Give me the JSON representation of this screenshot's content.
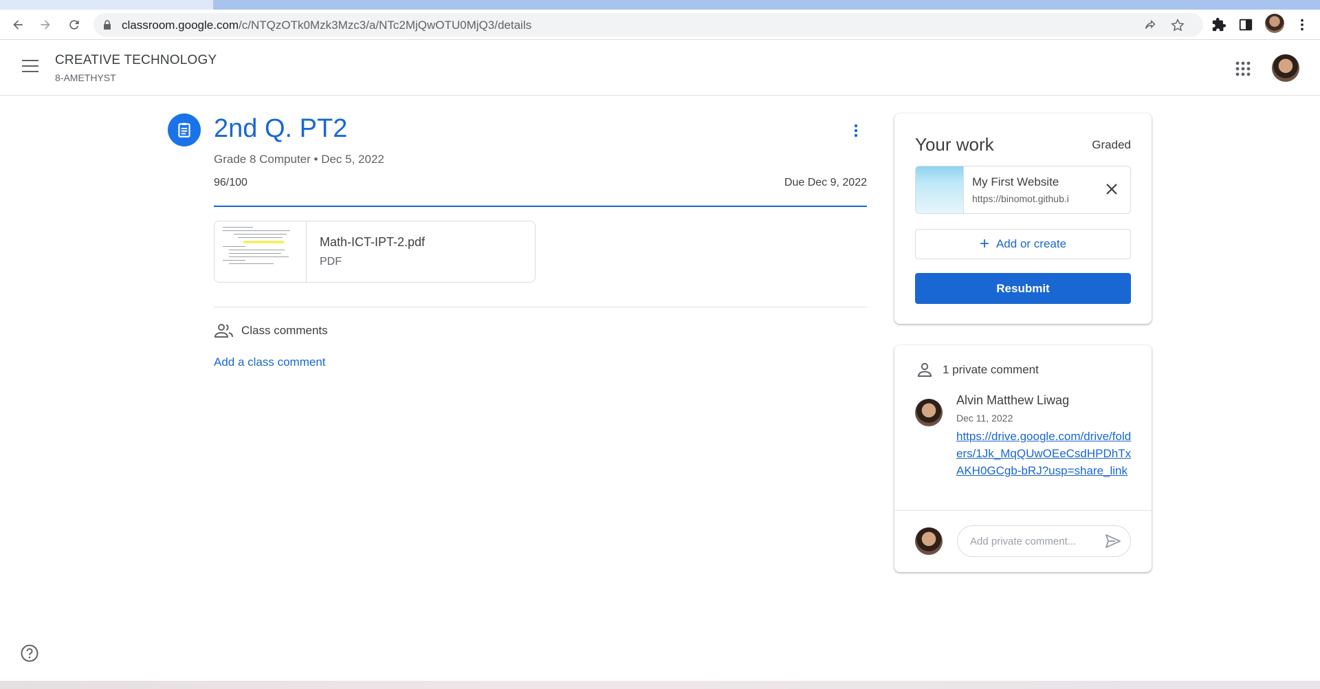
{
  "browser": {
    "url_host": "classroom.google.com",
    "url_path": "/c/NTQzOTk0Mzk3Mzc3/a/NTc2MjQwOTU0MjQ3/details"
  },
  "header": {
    "class_name": "CREATIVE TECHNOLOGY",
    "section": "8-AMETHYST"
  },
  "assignment": {
    "title": "2nd Q. PT2",
    "meta": "Grade 8 Computer • Dec 5, 2022",
    "points": "96/100",
    "due": "Due Dec 9, 2022",
    "attachment": {
      "name": "Math-ICT-IPT-2.pdf",
      "type": "PDF"
    },
    "class_comments_label": "Class comments",
    "add_class_comment": "Add a class comment"
  },
  "your_work": {
    "title": "Your work",
    "status": "Graded",
    "item": {
      "name": "My First Website",
      "url": "https://binomot.github.i"
    },
    "add_or_create": "Add or create",
    "resubmit": "Resubmit"
  },
  "private_comments": {
    "count_label": "1 private comment",
    "comments": [
      {
        "author": "Alvin Matthew Liwag",
        "date": "Dec 11, 2022",
        "text": "https://drive.google.com/drive/folders/1Jk_MqQUwOEeCsdHPDhTxAKH0GCgb-bRJ?usp=share_link"
      }
    ],
    "input_placeholder": "Add private comment..."
  },
  "colors": {
    "accent": "#1967d2",
    "icon_blue": "#1a73e8"
  },
  "icons": [
    "back-icon",
    "forward-icon",
    "reload-icon",
    "lock-icon",
    "share-icon",
    "star-icon",
    "extensions-icon",
    "sidepanel-icon",
    "kebab-icon",
    "hamburger-icon",
    "apps-icon",
    "assignment-icon",
    "more-vert-icon",
    "people-icon",
    "close-icon",
    "plus-icon",
    "person-icon",
    "send-icon",
    "help-icon"
  ]
}
